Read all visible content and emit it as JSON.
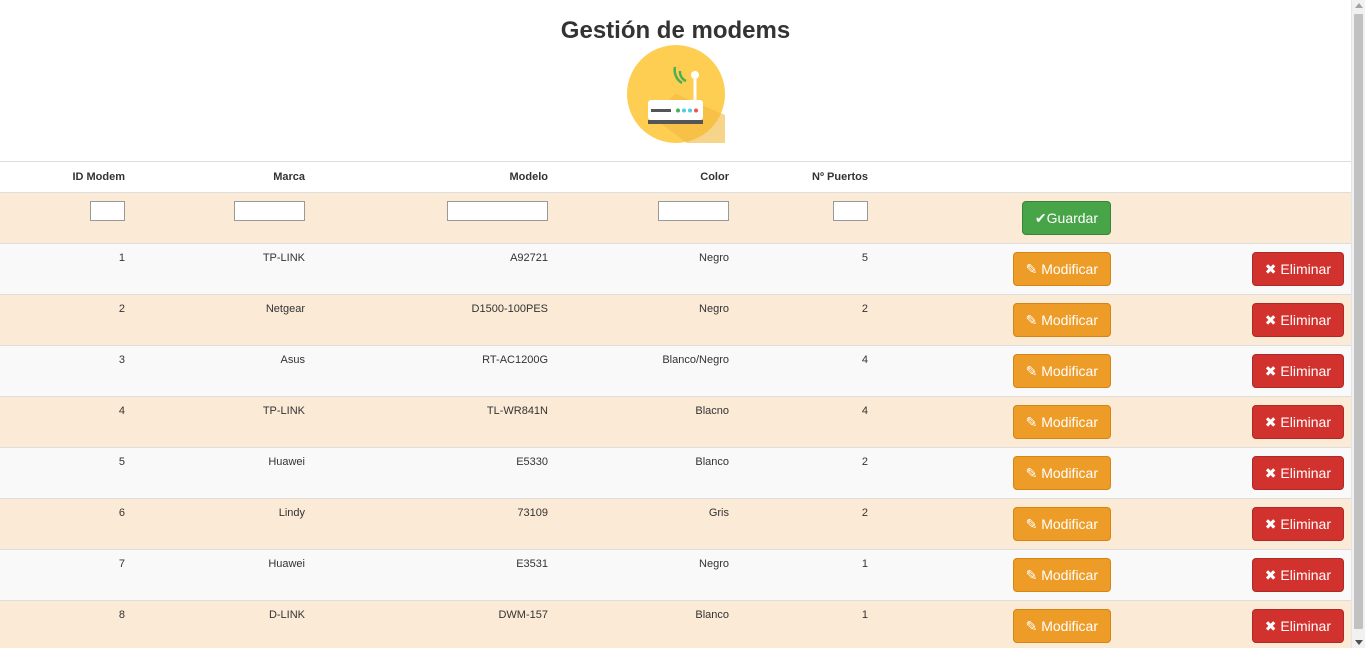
{
  "page": {
    "title": "Gestión de modems",
    "logo_icon": "router-icon"
  },
  "colors": {
    "accent_save": "#47a447",
    "accent_modify": "#ed9c28",
    "accent_delete": "#d2322d",
    "row_alt": "#fbead6"
  },
  "table": {
    "headers": [
      "ID Modem",
      "Marca",
      "Modelo",
      "Color",
      "Nº Puertos"
    ],
    "new_row": {
      "id": "",
      "marca": "",
      "modelo": "",
      "color": "",
      "puertos": "",
      "save_label": "Guardar",
      "save_icon": "check-icon"
    },
    "buttons": {
      "modify_label": "Modificar",
      "modify_icon": "pencil-icon",
      "delete_label": "Eliminar",
      "delete_icon": "remove-icon"
    },
    "rows": [
      {
        "id": "1",
        "marca": "TP-LINK",
        "modelo": "A92721",
        "color": "Negro",
        "puertos": "5"
      },
      {
        "id": "2",
        "marca": "Netgear",
        "modelo": "D1500-100PES",
        "color": "Negro",
        "puertos": "2"
      },
      {
        "id": "3",
        "marca": "Asus",
        "modelo": "RT-AC1200G",
        "color": "Blanco/Negro",
        "puertos": "4"
      },
      {
        "id": "4",
        "marca": "TP-LINK",
        "modelo": "TL-WR841N",
        "color": "Blacno",
        "puertos": "4"
      },
      {
        "id": "5",
        "marca": "Huawei",
        "modelo": "E5330",
        "color": "Blanco",
        "puertos": "2"
      },
      {
        "id": "6",
        "marca": "Lindy",
        "modelo": "73109",
        "color": "Gris",
        "puertos": "2"
      },
      {
        "id": "7",
        "marca": "Huawei",
        "modelo": "E3531",
        "color": "Negro",
        "puertos": "1"
      },
      {
        "id": "8",
        "marca": "D-LINK",
        "modelo": "DWM-157",
        "color": "Blanco",
        "puertos": "1"
      }
    ]
  }
}
